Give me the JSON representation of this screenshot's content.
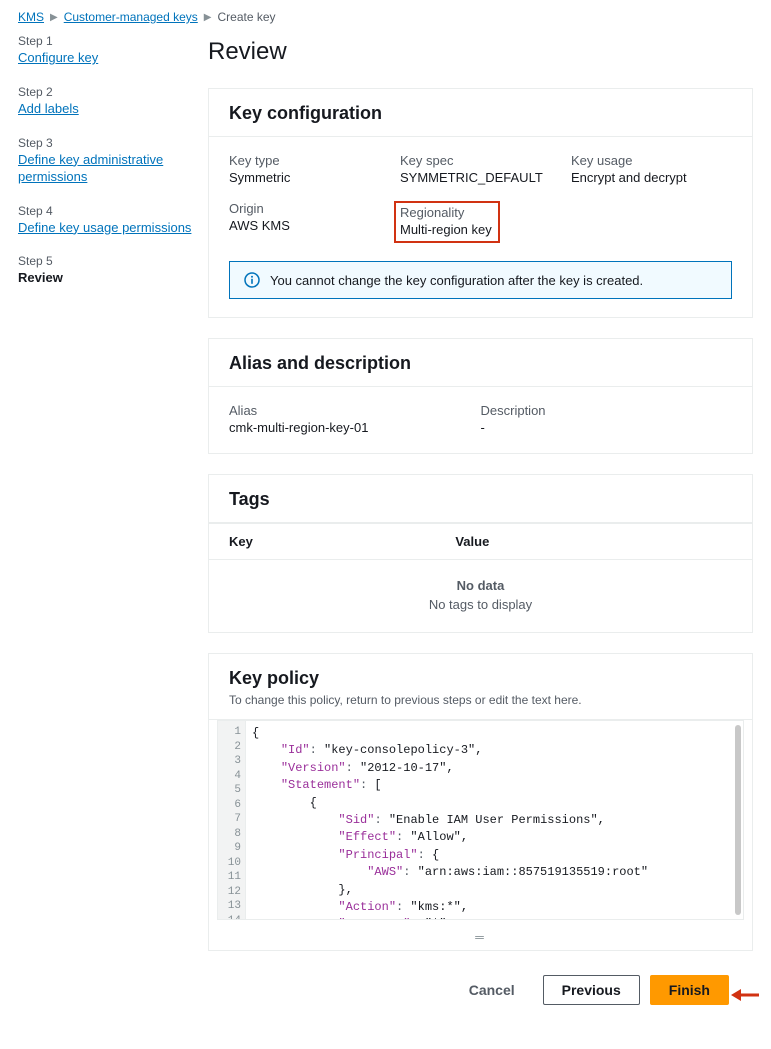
{
  "breadcrumb": {
    "root": "KMS",
    "parent": "Customer-managed keys",
    "current": "Create key"
  },
  "steps": [
    {
      "num": "Step 1",
      "label": "Configure key",
      "current": false
    },
    {
      "num": "Step 2",
      "label": "Add labels",
      "current": false
    },
    {
      "num": "Step 3",
      "label": "Define key administrative permissions",
      "current": false
    },
    {
      "num": "Step 4",
      "label": "Define key usage permissions",
      "current": false
    },
    {
      "num": "Step 5",
      "label": "Review",
      "current": true
    }
  ],
  "page_title": "Review",
  "key_config": {
    "heading": "Key configuration",
    "key_type_label": "Key type",
    "key_type_value": "Symmetric",
    "key_spec_label": "Key spec",
    "key_spec_value": "SYMMETRIC_DEFAULT",
    "key_usage_label": "Key usage",
    "key_usage_value": "Encrypt and decrypt",
    "origin_label": "Origin",
    "origin_value": "AWS KMS",
    "regionality_label": "Regionality",
    "regionality_value": "Multi-region key",
    "info_text": "You cannot change the key configuration after the key is created."
  },
  "alias_desc": {
    "heading": "Alias and description",
    "alias_label": "Alias",
    "alias_value": "cmk-multi-region-key-01",
    "desc_label": "Description",
    "desc_value": "-"
  },
  "tags": {
    "heading": "Tags",
    "col_key": "Key",
    "col_value": "Value",
    "empty_title": "No data",
    "empty_text": "No tags to display"
  },
  "key_policy": {
    "heading": "Key policy",
    "subtext": "To change this policy, return to previous steps or edit the text here.",
    "json": {
      "Id": "key-consolepolicy-3",
      "Version": "2012-10-17",
      "Statement": [
        {
          "Sid": "Enable IAM User Permissions",
          "Effect": "Allow",
          "Principal": {
            "AWS": "arn:aws:iam::857519135519:root"
          },
          "Action": "kms:*",
          "Resource": "*"
        }
      ]
    }
  },
  "actions": {
    "cancel": "Cancel",
    "previous": "Previous",
    "finish": "Finish"
  }
}
